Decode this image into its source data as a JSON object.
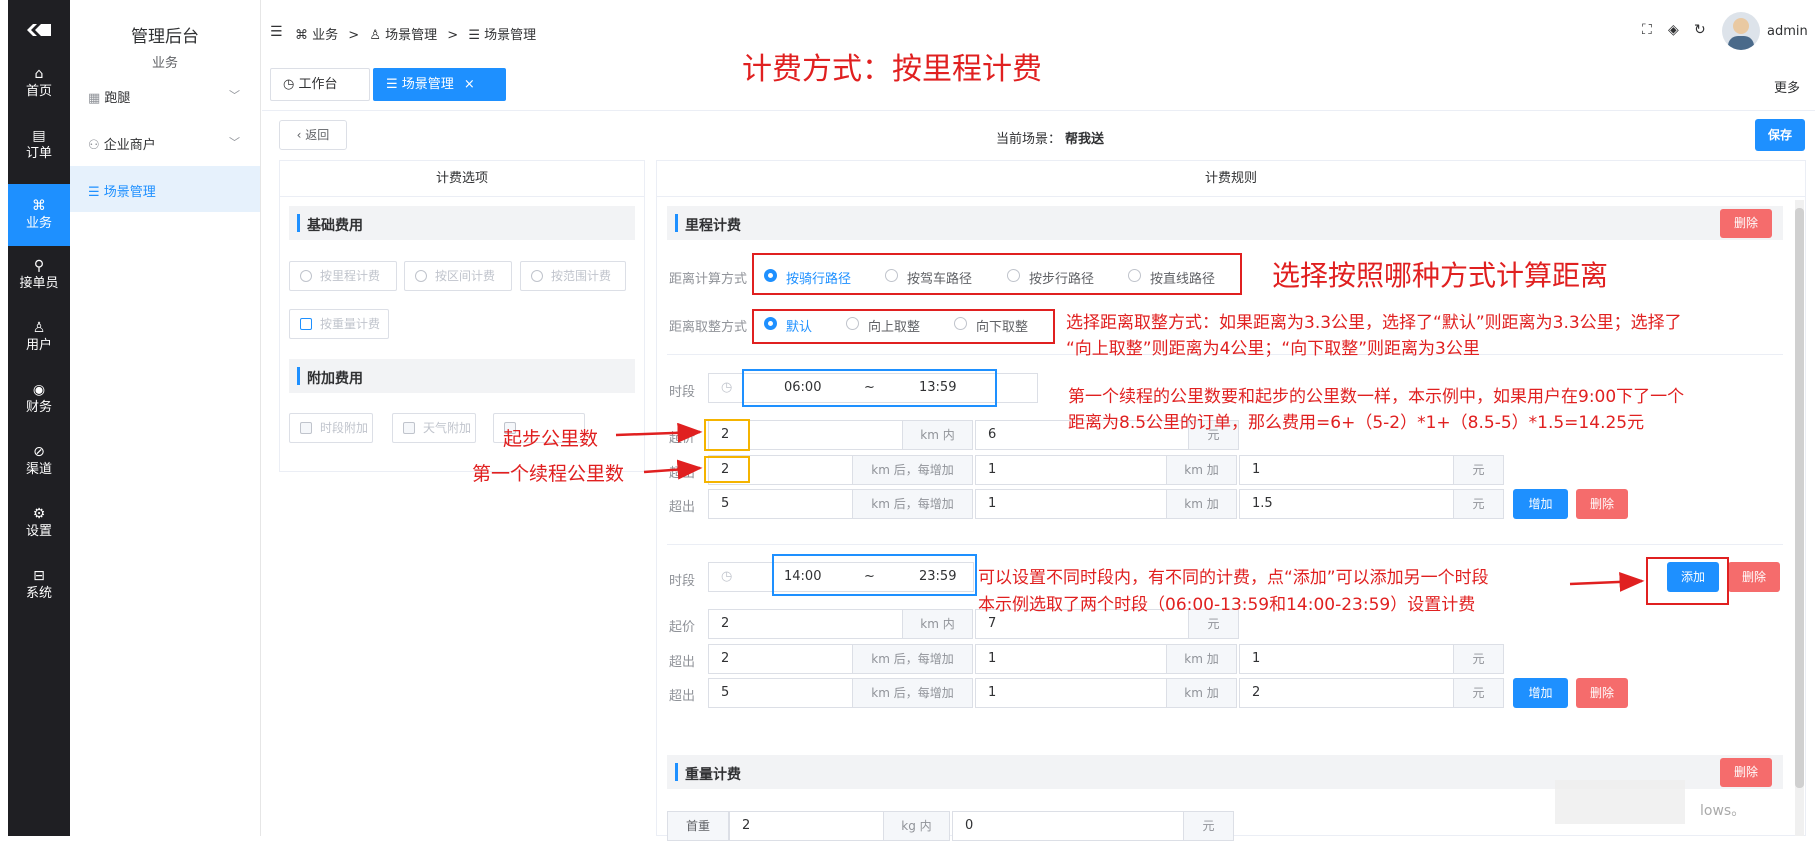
{
  "rail": {
    "items": [
      {
        "icon": "⌂",
        "label": "首页"
      },
      {
        "icon": "▤",
        "label": "订单"
      },
      {
        "icon": "⌘",
        "label": "业务"
      },
      {
        "icon": "⚲",
        "label": "接单员"
      },
      {
        "icon": "♙",
        "label": "用户"
      },
      {
        "icon": "◉",
        "label": "财务"
      },
      {
        "icon": "⊘",
        "label": "渠道"
      },
      {
        "icon": "⚙",
        "label": "设置"
      },
      {
        "icon": "⊟",
        "label": "系统"
      }
    ]
  },
  "sidebar": {
    "title": "管理后台",
    "subtitle": "业务",
    "items": [
      {
        "label": "跑腿"
      },
      {
        "label": "企业商户"
      },
      {
        "label": "场景管理"
      }
    ]
  },
  "header": {
    "breadcrumb": [
      "业务",
      "场景管理",
      "场景管理"
    ],
    "separator": ">",
    "username": "admin",
    "tabs": [
      {
        "label": "工作台"
      },
      {
        "label": "场景管理",
        "close": "×"
      }
    ],
    "more": "更多"
  },
  "toolbar": {
    "back": "返回",
    "scene_label": "当前场景：",
    "scene_value": "帮我送",
    "save": "保存"
  },
  "left_panel": {
    "title": "计费选项",
    "basic": "基础费用",
    "basic_options": [
      "按里程计费",
      "按区间计费",
      "按范围计费",
      "按重量计费"
    ],
    "extra": "附加费用",
    "extra_options": [
      "时段附加",
      "天气附加"
    ]
  },
  "right_panel": {
    "title": "计费规则",
    "mileage": "里程计费",
    "delete": "删除",
    "distance_label": "距离计算方式",
    "distance_options": [
      "按骑行路径",
      "按驾车路径",
      "按步行路径",
      "按直线路径"
    ],
    "rounding_label": "距离取整方式",
    "rounding_options": [
      "默认",
      "向上取整",
      "向下取整"
    ],
    "periods": [
      {
        "time_label": "时段",
        "start": "06:00",
        "tilde": "~",
        "end": "13:59",
        "rows": [
          {
            "label": "起价",
            "km": "2",
            "unit": "km 内",
            "price": "6",
            "yuan": "元"
          },
          {
            "label": "超出",
            "km": "2",
            "unit": "km 后，每增加",
            "add": "1",
            "kmadd": "km 加",
            "price": "1",
            "yuan": "元"
          },
          {
            "label": "超出",
            "km": "5",
            "unit": "km 后，每增加",
            "add": "1",
            "kmadd": "km 加",
            "price": "1.5",
            "yuan": "元"
          }
        ]
      },
      {
        "time_label": "时段",
        "start": "14:00",
        "tilde": "~",
        "end": "23:59",
        "rows": [
          {
            "label": "起价",
            "km": "2",
            "unit": "km 内",
            "price": "7",
            "yuan": "元"
          },
          {
            "label": "超出",
            "km": "2",
            "unit": "km 后，每增加",
            "add": "1",
            "kmadd": "km 加",
            "price": "1",
            "yuan": "元"
          },
          {
            "label": "超出",
            "km": "5",
            "unit": "km 后，每增加",
            "add": "1",
            "kmadd": "km 加",
            "price": "2",
            "yuan": "元"
          }
        ]
      }
    ],
    "add_row": "增加",
    "add_period": "添加",
    "weight": "重量计费",
    "weight_row": {
      "label": "首重",
      "kg": "2",
      "unit": "kg 内",
      "price": "0",
      "yuan": "元"
    }
  },
  "annotations": {
    "title": "计费方式：按里程计费",
    "distance": "选择按照哪种方式计算距离",
    "rounding_1": "选择距离取整方式：如果距离为3.3公里，选择了“默认”则距离为3.3公里；选择了",
    "rounding_2": "“向上取整”则距离为4公里；“向下取整”则距离为3公里",
    "continue_1": "第一个续程的公里数要和起步的公里数一样，本示例中，如果用户在9:00下了一个",
    "continue_2": "距离为8.5公里的订单，那么费用=6+（5-2）*1+（8.5-5）*1.5=14.25元",
    "start_km": "起步公里数",
    "first_km": "第一个续程公里数",
    "period_1": "可以设置不同时段内，有不同的计费，点“添加”可以添加另一个时段",
    "period_2": "本示例选取了两个时段（06:00-13:59和14:00-23:59）设置计费"
  },
  "watermark": "lows。"
}
